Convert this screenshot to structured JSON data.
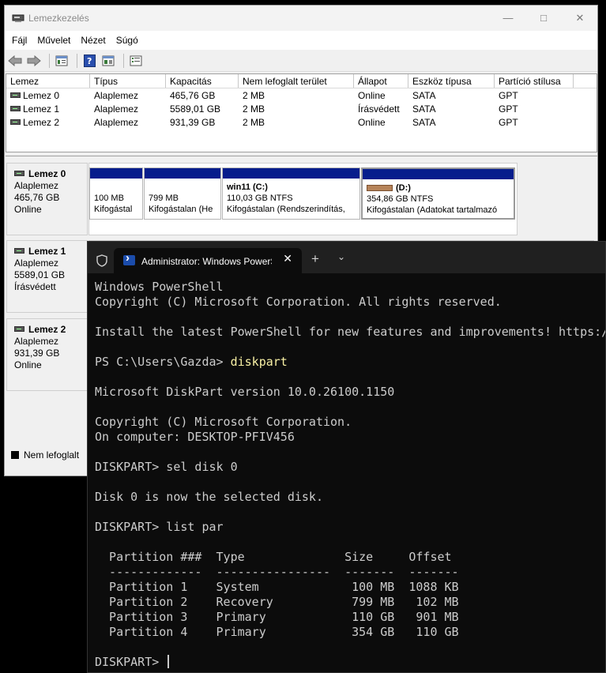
{
  "disk_mgmt": {
    "title": "Lemezkezelés",
    "menu": [
      "Fájl",
      "Művelet",
      "Nézet",
      "Súgó"
    ],
    "columns": [
      "Lemez",
      "Típus",
      "Kapacitás",
      "Nem lefoglalt terület",
      "Állapot",
      "Eszköz típusa",
      "Partíció stílusa"
    ],
    "rows": [
      [
        "Lemez 0",
        "Alaplemez",
        "465,76 GB",
        "2 MB",
        "Online",
        "SATA",
        "GPT"
      ],
      [
        "Lemez 1",
        "Alaplemez",
        "5589,01 GB",
        "2 MB",
        "Írásvédett",
        "SATA",
        "GPT"
      ],
      [
        "Lemez 2",
        "Alaplemez",
        "931,39 GB",
        "2 MB",
        "Online",
        "SATA",
        "GPT"
      ]
    ],
    "disks": [
      {
        "name": "Lemez 0",
        "type": "Alaplemez",
        "size": "465,76 GB",
        "status": "Online"
      },
      {
        "name": "Lemez 1",
        "type": "Alaplemez",
        "size": "5589,01 GB",
        "status": "Írásvédett"
      },
      {
        "name": "Lemez 2",
        "type": "Alaplemez",
        "size": "931,39 GB",
        "status": "Online"
      }
    ],
    "partitions": [
      {
        "name": "",
        "size": "100 MB",
        "status": "Kifogástal"
      },
      {
        "name": "",
        "size": "799 MB",
        "status": "Kifogástalan (He"
      },
      {
        "name": "win11  (C:)",
        "size": "110,03 GB NTFS",
        "status": "Kifogástalan (Rendszerindítás,"
      },
      {
        "name": "(D:)",
        "size": "354,86 GB NTFS",
        "status": "Kifogástalan (Adatokat tartalmazó"
      }
    ],
    "legend": "Nem lefoglalt",
    "accent_color": "#071d8c"
  },
  "terminal": {
    "tab_title": "Administrator: Windows PowerShell",
    "lines": [
      "Windows PowerShell",
      "Copyright (C) Microsoft Corporation. All rights reserved.",
      "",
      "Install the latest PowerShell for new features and improvements! https://aka.ms/PSWindows",
      "",
      "PS C:\\Users\\Gazda> ",
      "",
      "Microsoft DiskPart version 10.0.26100.1150",
      "",
      "Copyright (C) Microsoft Corporation.",
      "On computer: DESKTOP-PFIV456",
      "",
      "DISKPART> sel disk 0",
      "",
      "Disk 0 is now the selected disk.",
      "",
      "DISKPART> list par",
      "",
      "  Partition ###  Type              Size     Offset",
      "  -------------  ----------------  -------  -------",
      "  Partition 1    System             100 MB  1088 KB",
      "  Partition 2    Recovery           799 MB   102 MB",
      "  Partition 3    Primary            110 GB   901 MB",
      "  Partition 4    Primary            354 GB   110 GB",
      "",
      "DISKPART> "
    ],
    "command": "diskpart",
    "command_line_index": 5
  }
}
